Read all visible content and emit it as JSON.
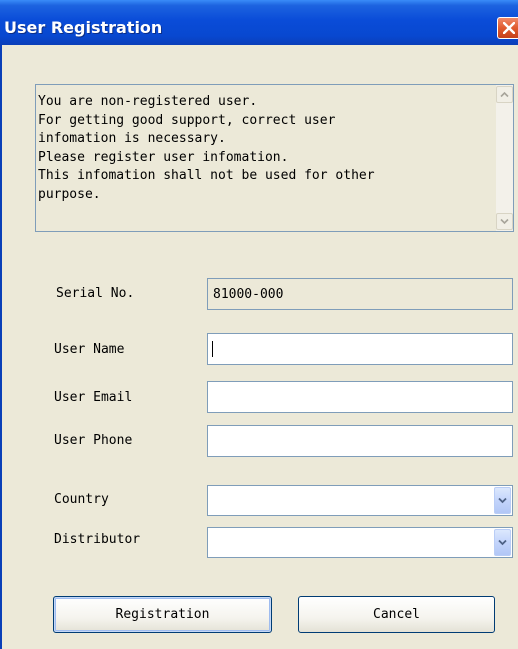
{
  "window": {
    "title": "User Registration"
  },
  "notice": {
    "lines": [
      "You are non-registered user.",
      "For getting good support, correct user",
      "infomation is necessary.",
      "Please register user infomation.",
      "This infomation shall not be used for other",
      "purpose."
    ]
  },
  "form": {
    "serial": {
      "label": "Serial No.",
      "value": "81000-000"
    },
    "user_name": {
      "label": "User Name",
      "value": ""
    },
    "user_email": {
      "label": "User Email",
      "value": ""
    },
    "user_phone": {
      "label": "User Phone",
      "value": ""
    },
    "country": {
      "label": "Country",
      "value": ""
    },
    "distributor": {
      "label": "Distributor",
      "value": ""
    }
  },
  "buttons": {
    "register_label": "Registration",
    "cancel_label": "Cancel"
  },
  "colors": {
    "title_bar": "#0a4cd8",
    "dialog_bg": "#ece9d8",
    "close_button": "#e05a2e",
    "field_border": "#7f9db9"
  },
  "icons": {
    "close": "close-icon",
    "scroll_up": "scroll-up-arrow-icon",
    "scroll_down": "scroll-down-arrow-icon",
    "dropdown": "chevron-down-icon"
  }
}
